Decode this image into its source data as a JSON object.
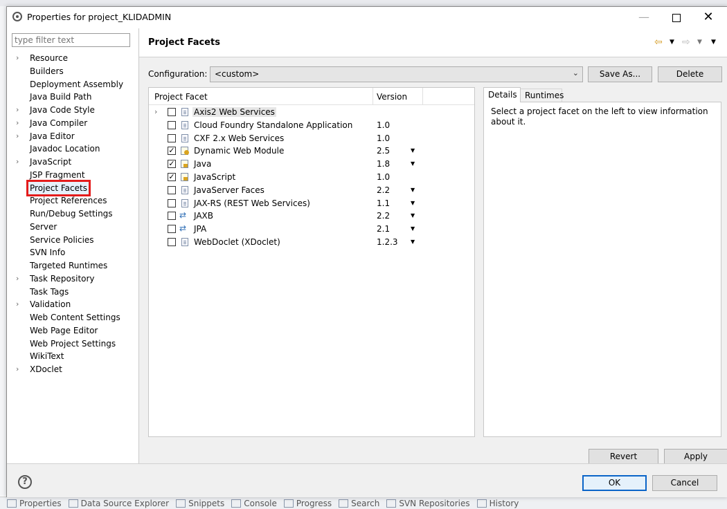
{
  "window": {
    "title": "Properties for project_KLIDADMIN"
  },
  "nav": {
    "filter_placeholder": "type filter text",
    "items": [
      {
        "label": "Resource",
        "expandable": true
      },
      {
        "label": "Builders",
        "expandable": false
      },
      {
        "label": "Deployment Assembly",
        "expandable": false
      },
      {
        "label": "Java Build Path",
        "expandable": false
      },
      {
        "label": "Java Code Style",
        "expandable": true
      },
      {
        "label": "Java Compiler",
        "expandable": true
      },
      {
        "label": "Java Editor",
        "expandable": true
      },
      {
        "label": "Javadoc Location",
        "expandable": false
      },
      {
        "label": "JavaScript",
        "expandable": true
      },
      {
        "label": "JSP Fragment",
        "expandable": false
      },
      {
        "label": "Project Facets",
        "expandable": false,
        "selected": true
      },
      {
        "label": "Project References",
        "expandable": false
      },
      {
        "label": "Run/Debug Settings",
        "expandable": false
      },
      {
        "label": "Server",
        "expandable": false
      },
      {
        "label": "Service Policies",
        "expandable": false
      },
      {
        "label": "SVN Info",
        "expandable": false
      },
      {
        "label": "Targeted Runtimes",
        "expandable": false
      },
      {
        "label": "Task Repository",
        "expandable": true
      },
      {
        "label": "Task Tags",
        "expandable": false
      },
      {
        "label": "Validation",
        "expandable": true
      },
      {
        "label": "Web Content Settings",
        "expandable": false
      },
      {
        "label": "Web Page Editor",
        "expandable": false
      },
      {
        "label": "Web Project Settings",
        "expandable": false
      },
      {
        "label": "WikiText",
        "expandable": false
      },
      {
        "label": "XDoclet",
        "expandable": true
      }
    ]
  },
  "main": {
    "title": "Project Facets",
    "configuration_label": "Configuration:",
    "configuration_value": "<custom>",
    "save_as_label": "Save As...",
    "delete_label": "Delete",
    "facet_column": "Project Facet",
    "version_column": "Version",
    "facets": [
      {
        "name": "Axis2 Web Services",
        "version": "",
        "checked": false,
        "expandable": true,
        "icon": "document-icon",
        "highlighted": true,
        "has_dropdown": false
      },
      {
        "name": "Cloud Foundry Standalone Application",
        "version": "1.0",
        "checked": false,
        "icon": "document-icon",
        "has_dropdown": false
      },
      {
        "name": "CXF 2.x Web Services",
        "version": "1.0",
        "checked": false,
        "icon": "document-icon",
        "has_dropdown": false
      },
      {
        "name": "Dynamic Web Module",
        "version": "2.5",
        "checked": true,
        "icon": "web-module-icon",
        "has_dropdown": true
      },
      {
        "name": "Java",
        "version": "1.8",
        "checked": true,
        "icon": "locked-facet-icon",
        "has_dropdown": true
      },
      {
        "name": "JavaScript",
        "version": "1.0",
        "checked": true,
        "icon": "locked-facet-icon",
        "has_dropdown": false
      },
      {
        "name": "JavaServer Faces",
        "version": "2.2",
        "checked": false,
        "icon": "document-icon",
        "has_dropdown": true
      },
      {
        "name": "JAX-RS (REST Web Services)",
        "version": "1.1",
        "checked": false,
        "icon": "document-icon",
        "has_dropdown": true
      },
      {
        "name": "JAXB",
        "version": "2.2",
        "checked": false,
        "icon": "bidirectional-arrows-icon",
        "has_dropdown": true
      },
      {
        "name": "JPA",
        "version": "2.1",
        "checked": false,
        "icon": "bidirectional-arrows-icon",
        "has_dropdown": true
      },
      {
        "name": "WebDoclet (XDoclet)",
        "version": "1.2.3",
        "checked": false,
        "icon": "document-icon",
        "has_dropdown": true
      }
    ],
    "tabs": [
      {
        "label": "Details"
      },
      {
        "label": "Runtimes"
      }
    ],
    "details_text": "Select a project facet on the left to view information about it.",
    "revert_label": "Revert",
    "apply_label": "Apply"
  },
  "footer": {
    "ok_label": "OK",
    "cancel_label": "Cancel"
  },
  "ide_bottom": {
    "tabs": [
      "Properties",
      "Data Source Explorer",
      "Snippets",
      "Console",
      "Progress",
      "Search",
      "SVN Repositories",
      "History"
    ]
  }
}
